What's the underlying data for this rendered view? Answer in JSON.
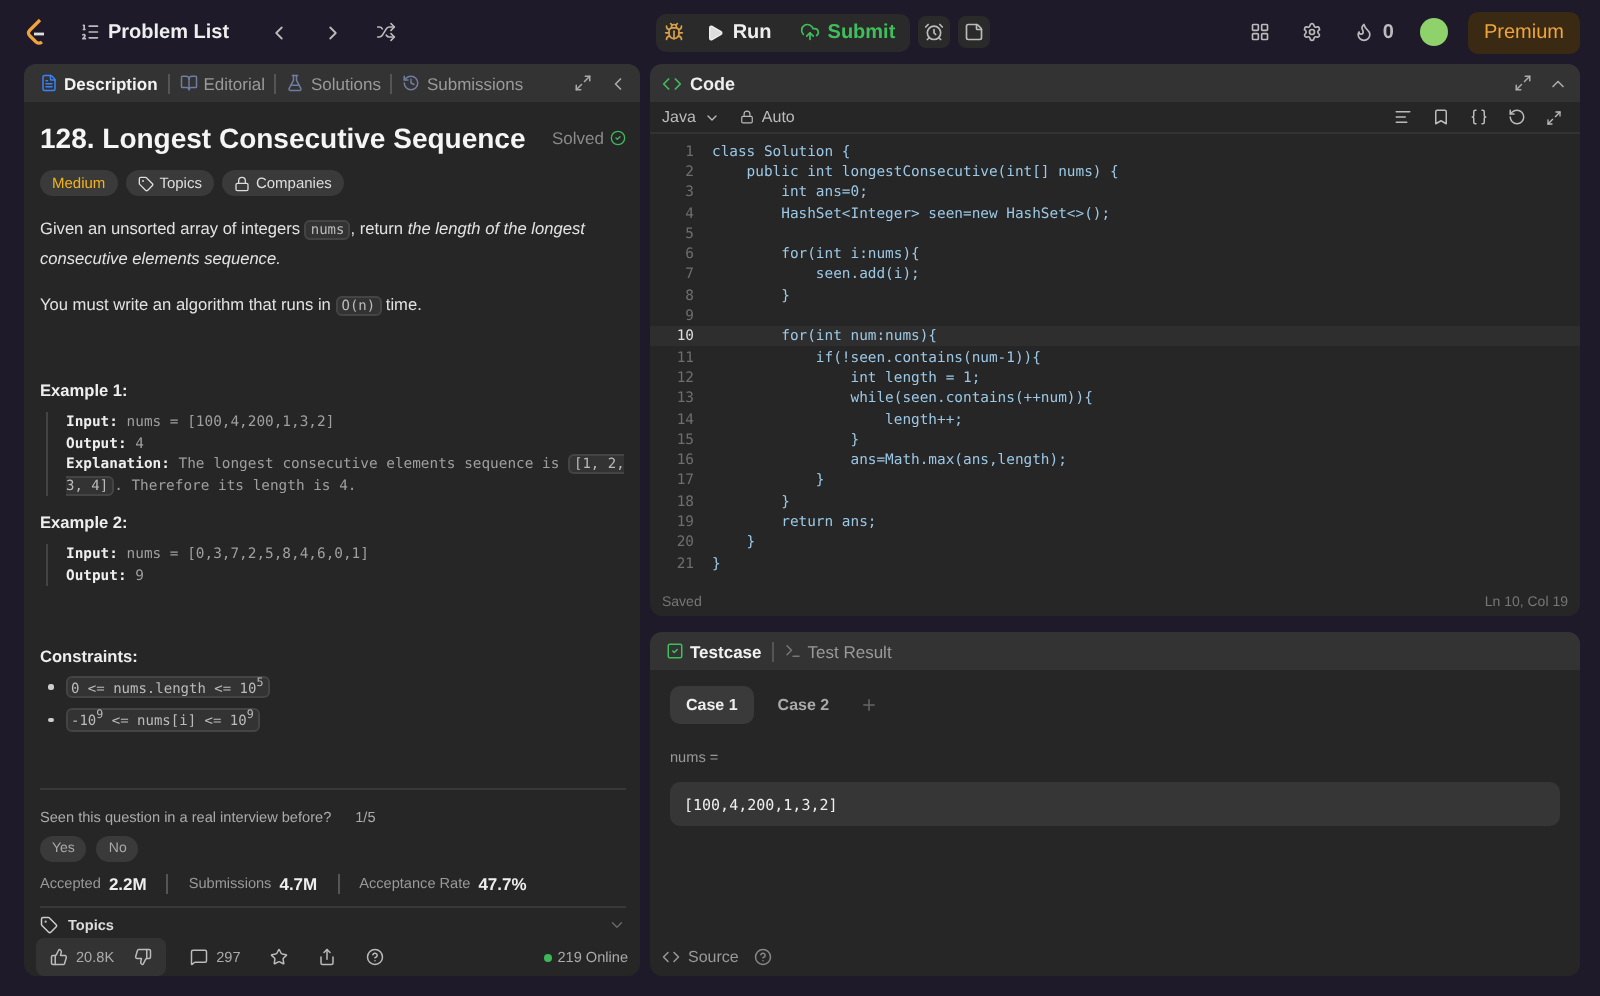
{
  "topbar": {
    "problem_list": "Problem List",
    "run": "Run",
    "submit": "Submit",
    "streak": "0",
    "premium": "Premium"
  },
  "left_tabs": [
    {
      "label": "Description",
      "selected": true
    },
    {
      "label": "Editorial",
      "selected": false
    },
    {
      "label": "Solutions",
      "selected": false
    },
    {
      "label": "Submissions",
      "selected": false
    }
  ],
  "problem": {
    "title": "128. Longest Consecutive Sequence",
    "status": "Solved",
    "difficulty": "Medium",
    "tags": [
      "Topics",
      "Companies"
    ],
    "paragraphs": [
      [
        {
          "kind": "text",
          "text": "Given an unsorted array of integers "
        },
        {
          "kind": "code",
          "text": "nums"
        },
        {
          "kind": "text",
          "text": ", return "
        },
        {
          "kind": "italic",
          "text": "the length of the longest consecutive elements sequence."
        }
      ],
      [
        {
          "kind": "text",
          "text": "You must write an algorithm that runs in "
        },
        {
          "kind": "code",
          "text": "O(n)"
        },
        {
          "kind": "text",
          "text": " time."
        }
      ]
    ],
    "examples": [
      {
        "title": "Example 1:",
        "lines": [
          [
            {
              "kind": "label",
              "text": "Input:"
            },
            {
              "kind": "text",
              "text": " nums = [100,4,200,1,3,2]"
            }
          ],
          [
            {
              "kind": "label",
              "text": "Output:"
            },
            {
              "kind": "text",
              "text": " 4"
            }
          ],
          [
            {
              "kind": "label",
              "text": "Explanation:"
            },
            {
              "kind": "text",
              "text": " The longest consecutive elements sequence is "
            },
            {
              "kind": "code",
              "text": "[1, 2, 3, 4]"
            },
            {
              "kind": "text",
              "text": ". Therefore its length is 4."
            }
          ]
        ]
      },
      {
        "title": "Example 2:",
        "lines": [
          [
            {
              "kind": "label",
              "text": "Input:"
            },
            {
              "kind": "text",
              "text": " nums = [0,3,7,2,5,8,4,6,0,1]"
            }
          ],
          [
            {
              "kind": "label",
              "text": "Output:"
            },
            {
              "kind": "text",
              "text": " 9"
            }
          ]
        ]
      }
    ],
    "constraints_title": "Constraints:",
    "constraints": [
      "0 <= nums.length <= 10$^{5}$",
      "-10$^{9}$ <= nums[i] <= 10$^{9}$"
    ],
    "interview_question": "Seen this question in a real interview before?",
    "interview_count": "1/5",
    "answers": [
      "Yes",
      "No"
    ],
    "stats": [
      {
        "label": "Accepted",
        "value": "2.2M"
      },
      {
        "label": "Submissions",
        "value": "4.7M"
      },
      {
        "label": "Acceptance Rate",
        "value": "47.7%"
      }
    ],
    "topics": "Topics"
  },
  "left_footer": {
    "likes": "20.8K",
    "comments": "297",
    "online": "219 Online"
  },
  "code_panel": {
    "title": "Code",
    "language": "Java",
    "mode": "Auto",
    "status": "Saved",
    "cursor": "Ln 10, Col 19",
    "lines": [
      {
        "n": "1",
        "code": "class Solution {",
        "current": false
      },
      {
        "n": "2",
        "code": "    public int longestConsecutive(int[] nums) {",
        "current": false
      },
      {
        "n": "3",
        "code": "        int ans=0;",
        "current": false
      },
      {
        "n": "4",
        "code": "        HashSet<Integer> seen=new HashSet<>();",
        "current": false
      },
      {
        "n": "5",
        "current": false
      },
      {
        "n": "6",
        "code": "        for(int i:nums){",
        "current": false
      },
      {
        "n": "7",
        "code": "            seen.add(i);",
        "current": false
      },
      {
        "n": "8",
        "code": "        }",
        "current": false
      },
      {
        "n": "9",
        "current": false
      },
      {
        "n": "10",
        "code": "        for(int num:nums){",
        "current": true
      },
      {
        "n": "11",
        "code": "            if(!seen.contains(num-1)){",
        "current": false
      },
      {
        "n": "12",
        "code": "                int length = 1;",
        "current": false
      },
      {
        "n": "13",
        "code": "                while(seen.contains(++num)){",
        "current": false
      },
      {
        "n": "14",
        "code": "                    length++;",
        "current": false
      },
      {
        "n": "15",
        "code": "                }",
        "current": false
      },
      {
        "n": "16",
        "code": "                ans=Math.max(ans,length);",
        "current": false
      },
      {
        "n": "17",
        "code": "            }",
        "current": false
      },
      {
        "n": "18",
        "code": "        }",
        "current": false
      },
      {
        "n": "19",
        "code": "        return ans;",
        "current": false
      },
      {
        "n": "20",
        "code": "    }",
        "current": false
      },
      {
        "n": "21",
        "code": "}",
        "current": false
      }
    ]
  },
  "test_tabs": [
    {
      "label": "Testcase",
      "selected": true
    },
    {
      "label": "Test Result",
      "selected": false
    }
  ],
  "cases": [
    {
      "label": "Case 1",
      "selected": true
    },
    {
      "label": "Case 2",
      "selected": false
    }
  ],
  "input": {
    "label": "nums =",
    "value": "[100,4,200,1,3,2]"
  },
  "test_footer": {
    "source": "Source"
  }
}
